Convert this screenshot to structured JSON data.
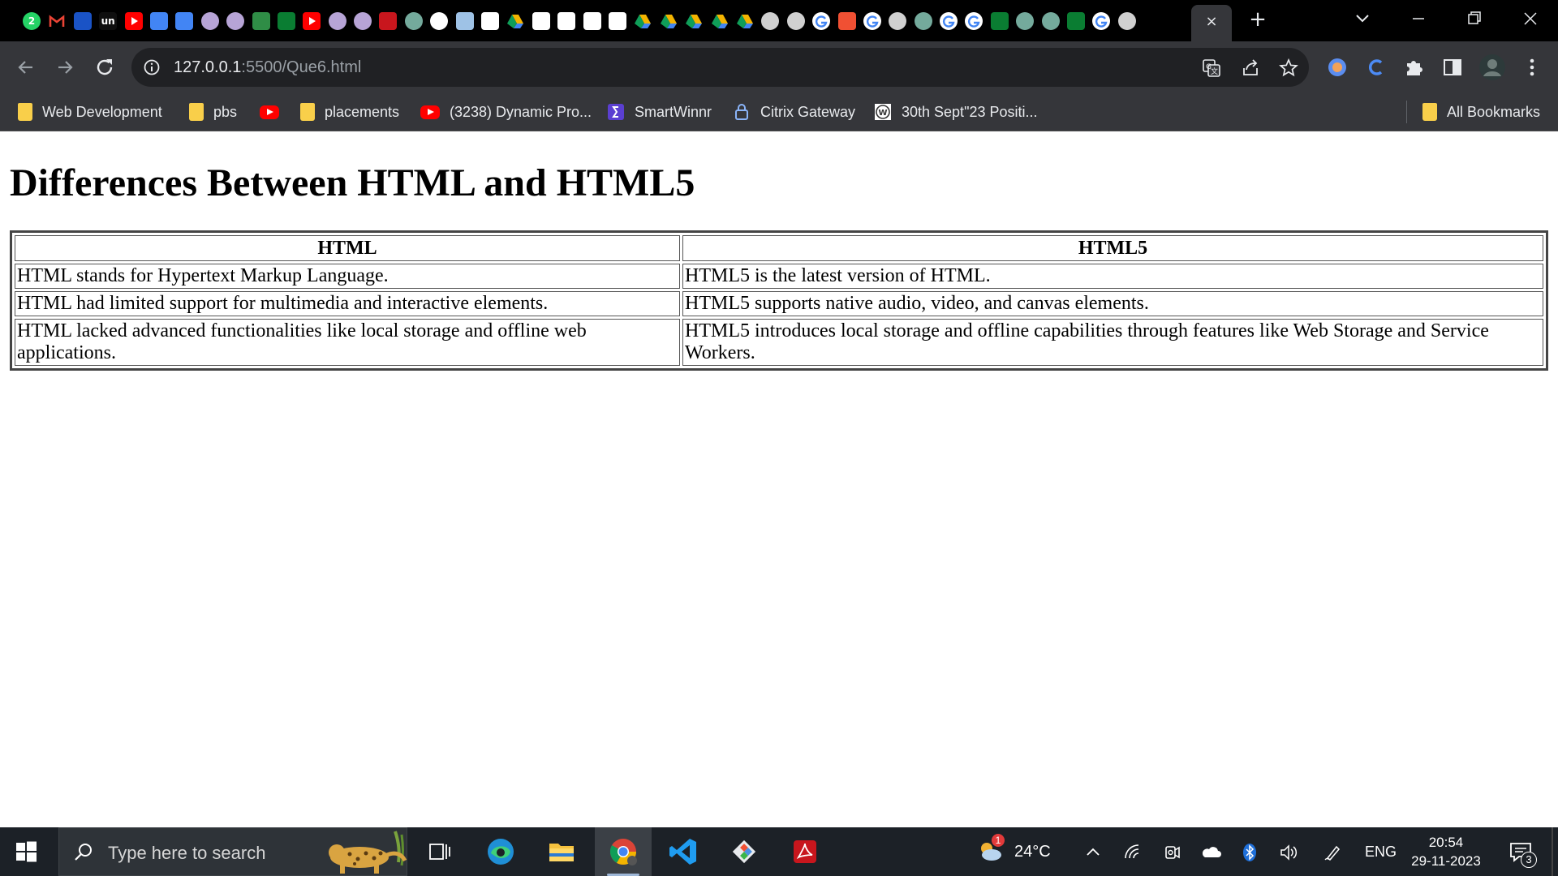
{
  "browser": {
    "tabs": {
      "favicons": [
        "whatsapp-icon",
        "gmail-icon",
        "alphabet-icon",
        "unacademy-icon",
        "youtube-icon",
        "google-docs-icon",
        "google-docs-icon",
        "avatar-icon",
        "avatar-icon",
        "geeksforgeeks-icon",
        "w-icon",
        "youtube-icon",
        "avatar-icon",
        "avatar-icon",
        "pdf-icon",
        "chatgpt-icon",
        "github-icon",
        "mountain-icon",
        "wordpress-icon",
        "google-drive-icon",
        "wordpress-icon",
        "wordpress-icon",
        "wordpress-icon",
        "wordpress-icon",
        "google-drive-icon",
        "google-drive-icon",
        "google-drive-icon",
        "google-drive-icon",
        "google-drive-icon",
        "globe-icon",
        "globe-icon",
        "google-icon",
        "git-icon",
        "google-icon",
        "globe-icon",
        "chatgpt-icon",
        "google-icon",
        "google-icon",
        "w-icon",
        "chatgpt-icon",
        "chatgpt-icon",
        "w-icon",
        "google-icon",
        "globe-icon"
      ],
      "whatsapp_badge": "2",
      "unacademy_text": "un",
      "active_tab_close": "×",
      "new_tab": "+"
    },
    "address": {
      "host": "127.0.0.1",
      "path": ":5500/Que6.html"
    },
    "bookmarks": [
      {
        "label": "Web Development",
        "icon": "folder-icon"
      },
      {
        "label": "pbs",
        "icon": "folder-icon"
      },
      {
        "label": "",
        "icon": "youtube-icon"
      },
      {
        "label": "placements",
        "icon": "folder-icon"
      },
      {
        "label": "(3238) Dynamic Pro...",
        "icon": "youtube-icon"
      },
      {
        "label": "SmartWinnr",
        "icon": "smartwinnr-icon"
      },
      {
        "label": "Citrix Gateway",
        "icon": "lock-icon"
      },
      {
        "label": "30th Sept\"23 Positi...",
        "icon": "wordpress-icon"
      }
    ],
    "all_bookmarks": "All Bookmarks"
  },
  "page": {
    "title": "Differences Between HTML and HTML5",
    "table": {
      "headers": [
        "HTML",
        "HTML5"
      ],
      "rows": [
        [
          "HTML stands for Hypertext Markup Language.",
          "HTML5 is the latest version of HTML."
        ],
        [
          "HTML had limited support for multimedia and interactive elements.",
          "HTML5 supports native audio, video, and canvas elements."
        ],
        [
          "HTML lacked advanced functionalities like local storage and offline web applications.",
          "HTML5 introduces local storage and offline capabilities through features like Web Storage and Service Workers."
        ]
      ]
    }
  },
  "taskbar": {
    "search_placeholder": "Type here to search",
    "apps": [
      "edge-icon",
      "file-explorer-icon",
      "chrome-icon",
      "vscode-icon",
      "git-gui-icon",
      "acrobat-icon"
    ],
    "weather": {
      "temp": "24°C",
      "badge": "1"
    },
    "language": "ENG",
    "time": "20:54",
    "date": "29-11-2023",
    "notifications": "3"
  },
  "colors": {
    "tabstrip": "#000000",
    "toolbar": "#35363a",
    "omnibox": "#202124",
    "taskbar": "#1c2127"
  }
}
